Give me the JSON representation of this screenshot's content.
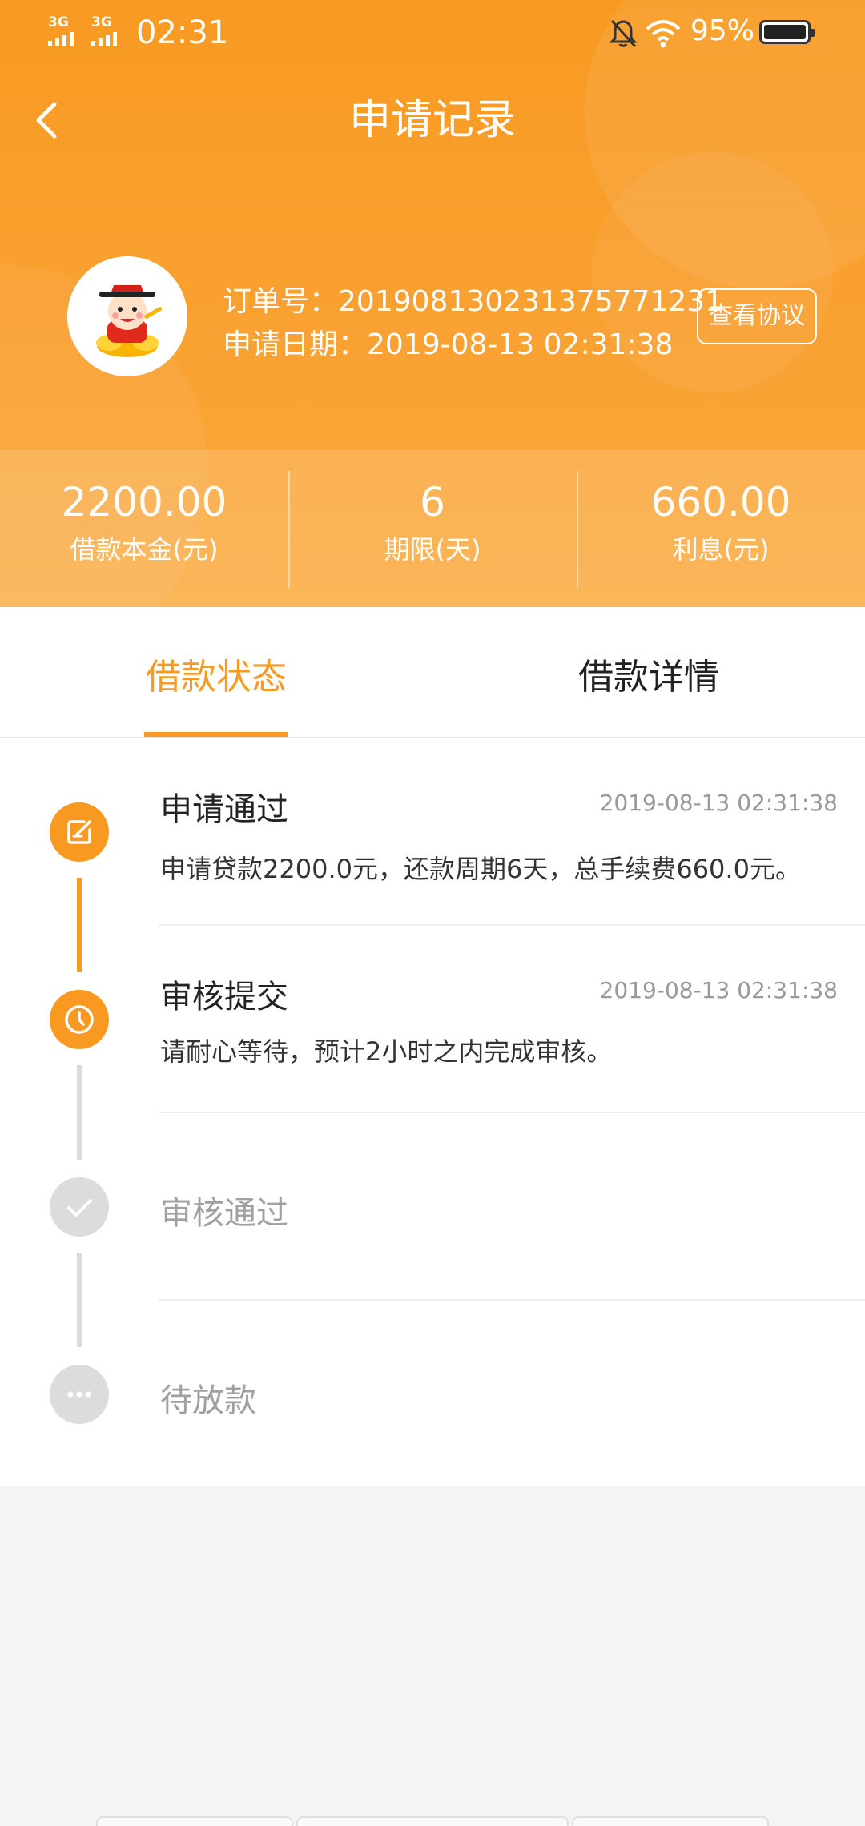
{
  "status_bar": {
    "signal_1": "3G",
    "signal_2": "3G",
    "time": "02:31",
    "battery_percent": "95%",
    "icons": [
      "signal-icon",
      "mute-bell-icon",
      "wifi-icon",
      "battery-icon"
    ]
  },
  "header": {
    "title": "申请记录",
    "back_icon": "chevron-left-icon",
    "order_label": "订单号：",
    "order_number": "201908130231375771231",
    "date_label": "申请日期：",
    "date_value": "2019-08-13 02:31:38",
    "view_agreement": "查看协议"
  },
  "stats": [
    {
      "value": "2200.00",
      "label": "借款本金(元)"
    },
    {
      "value": "6",
      "label": "期限(天)"
    },
    {
      "value": "660.00",
      "label": "利息(元)"
    }
  ],
  "tabs": [
    {
      "label": "借款状态",
      "active": true
    },
    {
      "label": "借款详情",
      "active": false
    }
  ],
  "timeline": [
    {
      "title": "申请通过",
      "time": "2019-08-13 02:31:38",
      "desc": "申请贷款2200.0元，还款周期6天，总手续费660.0元。",
      "status": "done",
      "icon": "edit-icon"
    },
    {
      "title": "审核提交",
      "time": "2019-08-13 02:31:38",
      "desc": "请耐心等待，预计2小时之内完成审核。",
      "status": "done",
      "icon": "clock-icon"
    },
    {
      "title": "审核通过",
      "status": "pending",
      "icon": "check-icon"
    },
    {
      "title": "待放款",
      "status": "pending",
      "icon": "more-dots-icon"
    }
  ],
  "colors": {
    "accent": "#f89a22",
    "pending": "#dcdcdc"
  }
}
